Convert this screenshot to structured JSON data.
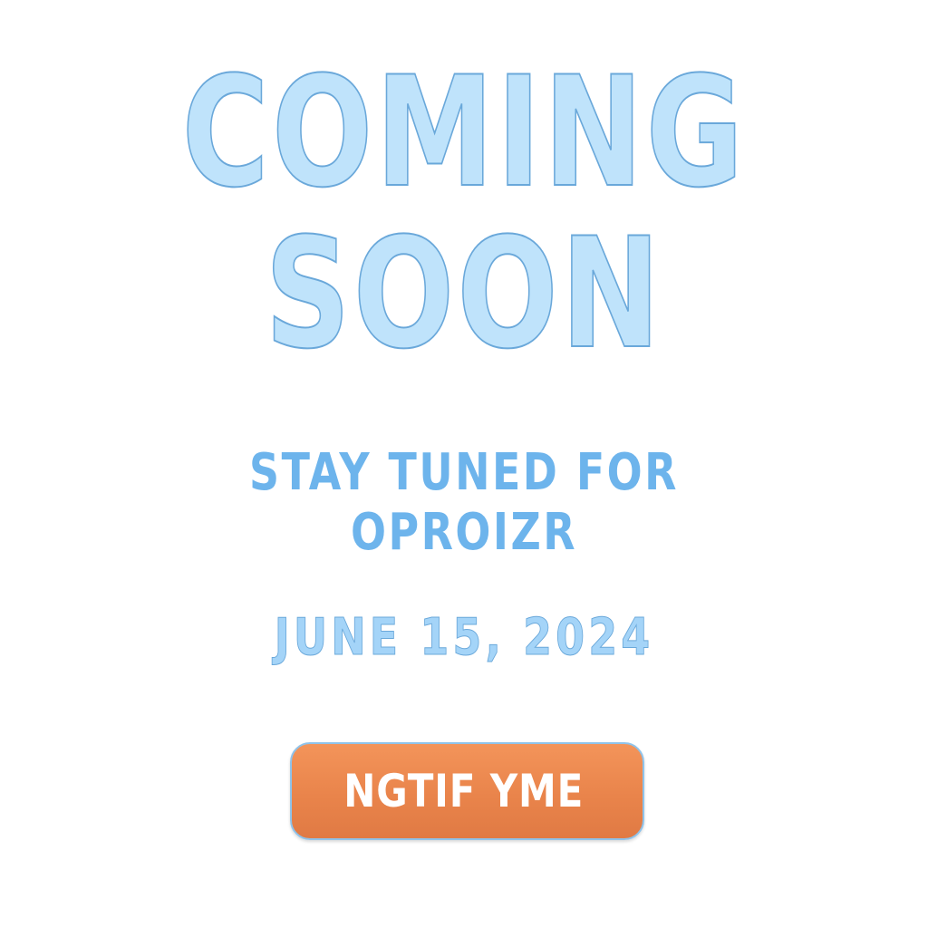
{
  "headline": {
    "line1": "COMING",
    "line2": "SOON"
  },
  "subheading": {
    "line1": "STAY TUNED FOR",
    "line2": "OPROIZR"
  },
  "launch_date": "JUNE 15, 2024",
  "cta": {
    "label": "NGTIF YME"
  },
  "colors": {
    "headline_fill": "#bfe3fb",
    "headline_stroke": "#6aa8da",
    "subheading": "#6db4ec",
    "date": "#a4d4f8",
    "button": "#ec8a4e",
    "button_text": "#ffffff",
    "background": "#ffffff"
  }
}
